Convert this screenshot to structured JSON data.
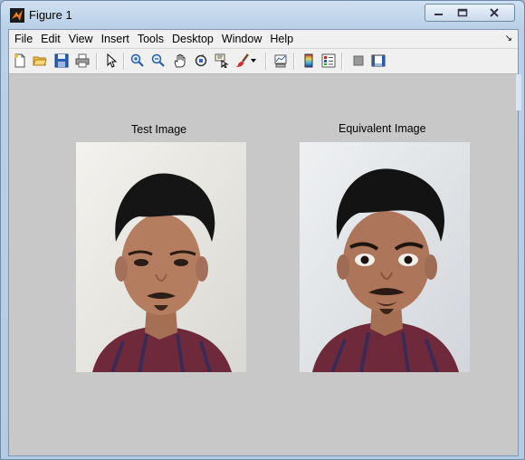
{
  "window": {
    "title": "Figure 1"
  },
  "menubar": {
    "items": [
      "File",
      "Edit",
      "View",
      "Insert",
      "Tools",
      "Desktop",
      "Window",
      "Help"
    ]
  },
  "toolbar": {
    "buttons": [
      "new-figure-icon",
      "open-file-icon",
      "save-icon",
      "print-icon",
      "edit-plot-arrow-icon",
      "zoom-in-icon",
      "zoom-out-icon",
      "pan-hand-icon",
      "rotate-3d-icon",
      "data-cursor-icon",
      "brush-icon",
      "brush-dropdown-arrow-icon",
      "link-plot-icon",
      "insert-colorbar-icon",
      "insert-legend-icon",
      "hide-plot-tools-icon",
      "show-plot-tools-icon"
    ]
  },
  "figure": {
    "axes": [
      {
        "title": "Test Image"
      },
      {
        "title": "Equivalent Image"
      }
    ]
  },
  "colors": {
    "figure_bg": "#c8c8c8",
    "menubar_bg": "#f0f0f0",
    "window_frame": "#b9d0e8"
  }
}
